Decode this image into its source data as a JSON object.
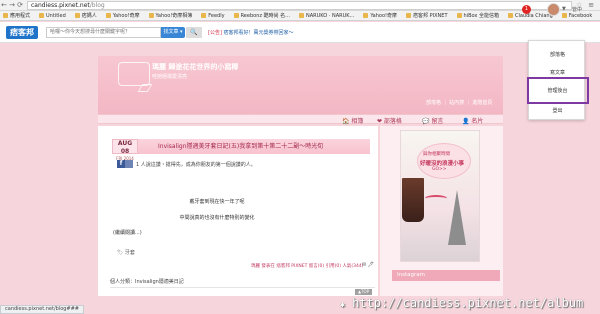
{
  "browser": {
    "url_host": "candiess.pixnet.net",
    "url_path": "/blog",
    "back": "←",
    "forward": "→",
    "reload": "⟳",
    "star": "☆",
    "menu": "≡",
    "bookmarks": [
      "應用程式",
      "Untitled",
      "痞媽人",
      "Yahoo!奇摩",
      "Yahoo!奇摩相簿",
      "Feedly",
      "Reebonz 酷時尚 名...",
      "NARUKO · NARUK...",
      "Yahoo!奇摩",
      "痞客邦 PIXNET",
      "hiBox 全能信箱",
      "Claudia Chiang",
      "Facebook"
    ],
    "status": "candiess.pixnet.net/blog###"
  },
  "pixnet": {
    "logo": "痞客邦",
    "search_placeholder": "哈囉～你今天想搜尋什麼關鍵字呢？",
    "search_scope": "找文章 ▾",
    "search_btn": "🔍",
    "news_tag": "[公告]",
    "news_text": "痞客邦看好！萬元獎券帶回家～",
    "notif_count": "1",
    "user_label": "管中"
  },
  "menu": {
    "items": [
      "部落格",
      "寫文章",
      "管理後台",
      "登出"
    ]
  },
  "blog": {
    "title": "瑪麗 歸途花花世界的小窩椰",
    "subtitle": "哇她極端愛漂亮",
    "right_text": "部落格 ｜ 站內搜 ｜ 進階首頁",
    "tabs": [
      "🏠 相簿",
      "❤ 部落格",
      "💬 留言",
      "👤 名片"
    ]
  },
  "post": {
    "date_month_day": "AUG 08",
    "date_weekday": "FRI 2014",
    "title": "Invisalign隱適美牙套日記(五)我拿到第十第二十二副～時光旬",
    "fb_like": "f",
    "likes": "1 人說這讚・搶得先，成為你朋友的第一個說讚的人。",
    "body1": "戴牙套到現在快一年了呢",
    "body2": "中間說真的也沒有什麼特別的變化",
    "read_more": "(繼續閱讀...)",
    "tag_label": "🏷 牙套",
    "meta": "瑪麗 發表在 痞客邦 PIXNET 留言(0) 引用(0) 人氣(344)",
    "meta_icons": "✉ 🖊",
    "category": "個人分類：Invisalign隱適美日記",
    "top_btn": "▲TOP"
  },
  "sidebar": {
    "ad_line1": "與你相聚時間",
    "ad_line2": "好暖沒的浪漫小事",
    "ad_line3": "GO>>",
    "instagram_label": "Instagram"
  },
  "watermark": {
    "star": "✱",
    "text": "http://candiess.pixnet.net/album"
  }
}
